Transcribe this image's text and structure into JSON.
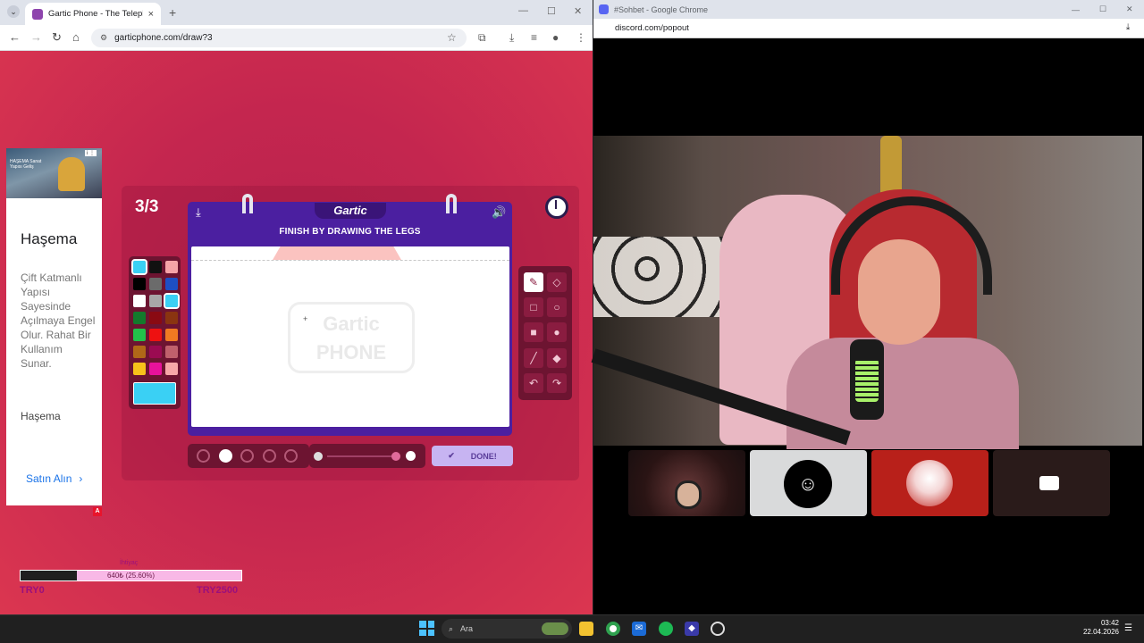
{
  "left_window": {
    "tab_title": "Gartic Phone - The Telephone G",
    "url": "garticphone.com/draw?3",
    "new_tab": "+",
    "tab_close": "×"
  },
  "ad": {
    "image_badge": "i ⋮",
    "image_small_text": "HAŞEMA Sanat Yapısı Geliş",
    "title": "Haşema",
    "description": "Çift Katmanlı Yapısı Sayesinde Açılmaya Engel Olur. Rahat Bir Kullanım Sunar.",
    "brand": "Haşema",
    "cta": "Satın Alın",
    "corner": "A"
  },
  "donation": {
    "label": "İhtiyaç",
    "progress_text": "640₺ (25.60%)",
    "progress_fraction": 0.256,
    "min_label": "TRY0",
    "max_label": "TRY2500"
  },
  "game": {
    "round": "3/3",
    "logo": "Gartic",
    "instruction": "FINISH BY DRAWING THE LEGS",
    "watermark": "Gartic PHONE",
    "done_label": "DONE!",
    "palette": [
      "#3ad0f4",
      "#111111",
      "#f5a3a8",
      "#000000",
      "#6b6b6b",
      "#1d4fc4",
      "#ffffff",
      "#a8a8a8",
      "#3ad0f4",
      "#137a2c",
      "#8a0a12",
      "#8a3410",
      "#22c24a",
      "#ee1111",
      "#f07a22",
      "#b06818",
      "#9b0b52",
      "#c0606c",
      "#f7c21a",
      "#e8129a",
      "#f7a8a8"
    ],
    "current_color": "#3ad0f4"
  },
  "discord": {
    "window_title": "#Sohbet - Google Chrome",
    "url": "discord.com/popout"
  },
  "taskbar": {
    "search_placeholder": "Ara",
    "time": "03:42",
    "date": "22.04.2026"
  },
  "colors": {
    "page_bg": "#c8244f",
    "canvas_frame": "#4b1fa0",
    "done_button": "#c7b4f2",
    "discord_tile_red": "#b8201a"
  }
}
